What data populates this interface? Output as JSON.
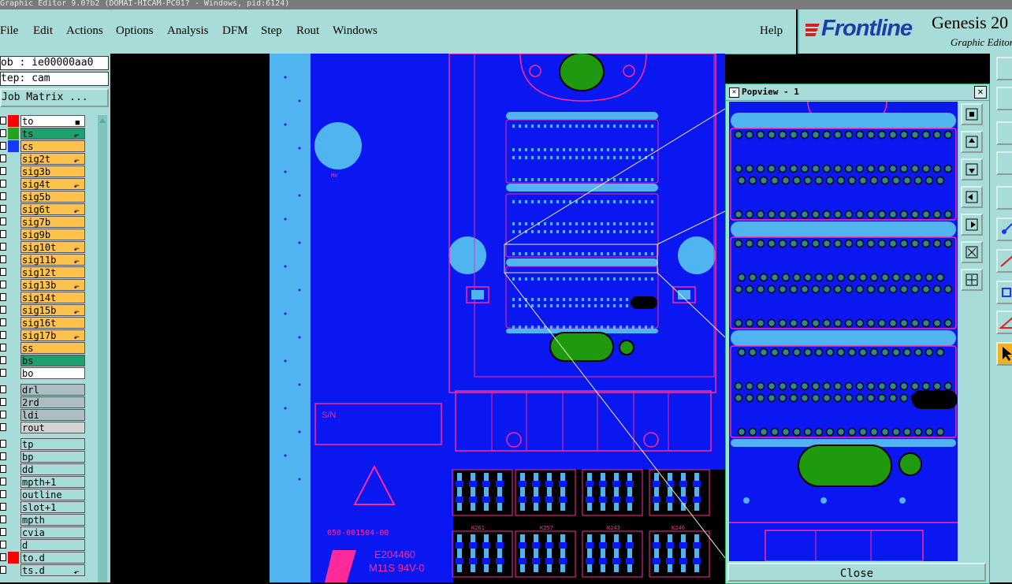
{
  "window": {
    "title": "Graphic Editor 9.0?b2 (DOMAI-HICAM-PC01? - Windows, pid:6124)"
  },
  "menu": {
    "items": [
      {
        "label": "File"
      },
      {
        "label": "Edit"
      },
      {
        "label": "Actions"
      },
      {
        "label": "Options"
      },
      {
        "label": "Analysis"
      },
      {
        "label": "DFM"
      },
      {
        "label": "Step"
      },
      {
        "label": "Rout"
      },
      {
        "label": "Windows"
      }
    ],
    "help": "Help"
  },
  "brand": {
    "name": "Frontline",
    "product": "Genesis 20",
    "subtitle": "Graphic Editor"
  },
  "leftpanel": {
    "job": "ob : ie00000aa0",
    "step": "tep: cam",
    "job_matrix": "Job Matrix ...",
    "layers": [
      {
        "name": "to",
        "bg": "#ffffff",
        "color": "#ff0000",
        "mark": "■"
      },
      {
        "name": "ts",
        "bg": "#1fa070",
        "color": "#26a01e",
        "mark": "⬐"
      },
      {
        "name": "cs",
        "bg": "#ffc24d",
        "color": "#1a37ff",
        "mark": ""
      },
      {
        "name": "sig2t",
        "bg": "#ffc24d",
        "color": "",
        "mark": "⬐"
      },
      {
        "name": "sig3b",
        "bg": "#ffc24d",
        "color": "",
        "mark": ""
      },
      {
        "name": "sig4t",
        "bg": "#ffc24d",
        "color": "",
        "mark": "⬐"
      },
      {
        "name": "sig5b",
        "bg": "#ffc24d",
        "color": "",
        "mark": ""
      },
      {
        "name": "sig6t",
        "bg": "#ffc24d",
        "color": "",
        "mark": "⬐"
      },
      {
        "name": "sig7b",
        "bg": "#ffc24d",
        "color": "",
        "mark": ""
      },
      {
        "name": "sig9b",
        "bg": "#ffc24d",
        "color": "",
        "mark": ""
      },
      {
        "name": "sig10t",
        "bg": "#ffc24d",
        "color": "",
        "mark": "⬐"
      },
      {
        "name": "sig11b",
        "bg": "#ffc24d",
        "color": "",
        "mark": "⬐"
      },
      {
        "name": "sig12t",
        "bg": "#ffc24d",
        "color": "",
        "mark": ""
      },
      {
        "name": "sig13b",
        "bg": "#ffc24d",
        "color": "",
        "mark": "⬐"
      },
      {
        "name": "sig14t",
        "bg": "#ffc24d",
        "color": "",
        "mark": ""
      },
      {
        "name": "sig15b",
        "bg": "#ffc24d",
        "color": "",
        "mark": "⬐"
      },
      {
        "name": "sig16t",
        "bg": "#ffc24d",
        "color": "",
        "mark": ""
      },
      {
        "name": "sig17b",
        "bg": "#ffc24d",
        "color": "",
        "mark": "⬐"
      },
      {
        "name": "ss",
        "bg": "#ffc24d",
        "color": "",
        "mark": ""
      },
      {
        "name": "bs",
        "bg": "#1fa070",
        "color": "",
        "mark": ""
      },
      {
        "name": "bo",
        "bg": "#ffffff",
        "color": "",
        "mark": ""
      },
      {
        "name": "drl",
        "bg": "#b0bcc4",
        "color": "",
        "mark": "",
        "gap": true
      },
      {
        "name": "2rd",
        "bg": "#b0bcc4",
        "color": "",
        "mark": ""
      },
      {
        "name": "ldi",
        "bg": "#b0bcc4",
        "color": "",
        "mark": ""
      },
      {
        "name": "rout",
        "bg": "#d4d4d4",
        "color": "",
        "mark": ""
      },
      {
        "name": "tp",
        "bg": "#a8dcd8",
        "color": "",
        "mark": "",
        "gap": true
      },
      {
        "name": "bp",
        "bg": "#a8dcd8",
        "color": "",
        "mark": ""
      },
      {
        "name": "dd",
        "bg": "#a8dcd8",
        "color": "",
        "mark": ""
      },
      {
        "name": "mpth+1",
        "bg": "#a8dcd8",
        "color": "",
        "mark": ""
      },
      {
        "name": "outline",
        "bg": "#a8dcd8",
        "color": "",
        "mark": ""
      },
      {
        "name": "slot+1",
        "bg": "#a8dcd8",
        "color": "",
        "mark": ""
      },
      {
        "name": "mpth",
        "bg": "#a8dcd8",
        "color": "",
        "mark": ""
      },
      {
        "name": "cvia",
        "bg": "#a8dcd8",
        "color": "",
        "mark": ""
      },
      {
        "name": "d",
        "bg": "#a8dcd8",
        "color": "",
        "mark": ""
      },
      {
        "name": "to.d",
        "bg": "#a8dcd8",
        "color": "#ff0000",
        "mark": ""
      },
      {
        "name": "ts.d",
        "bg": "#a8dcd8",
        "color": "",
        "mark": "⬐"
      }
    ]
  },
  "canvas": {
    "labels": {
      "sn": "S/N",
      "part": "050-001504-00",
      "ul1": "E204460",
      "ul2": "M11S 94V-0",
      "mh": "MH",
      "k261": "K261",
      "k257": "K257",
      "k243": "K243",
      "k246": "K246"
    }
  },
  "popview": {
    "title": "Popview - 1",
    "close": "Close"
  },
  "colors": {
    "board": "#0a17f0",
    "light_blue": "#4fb4f0",
    "magenta": "#ff2a9a",
    "green": "#1f9a10",
    "panel": "#a8dcd8"
  }
}
